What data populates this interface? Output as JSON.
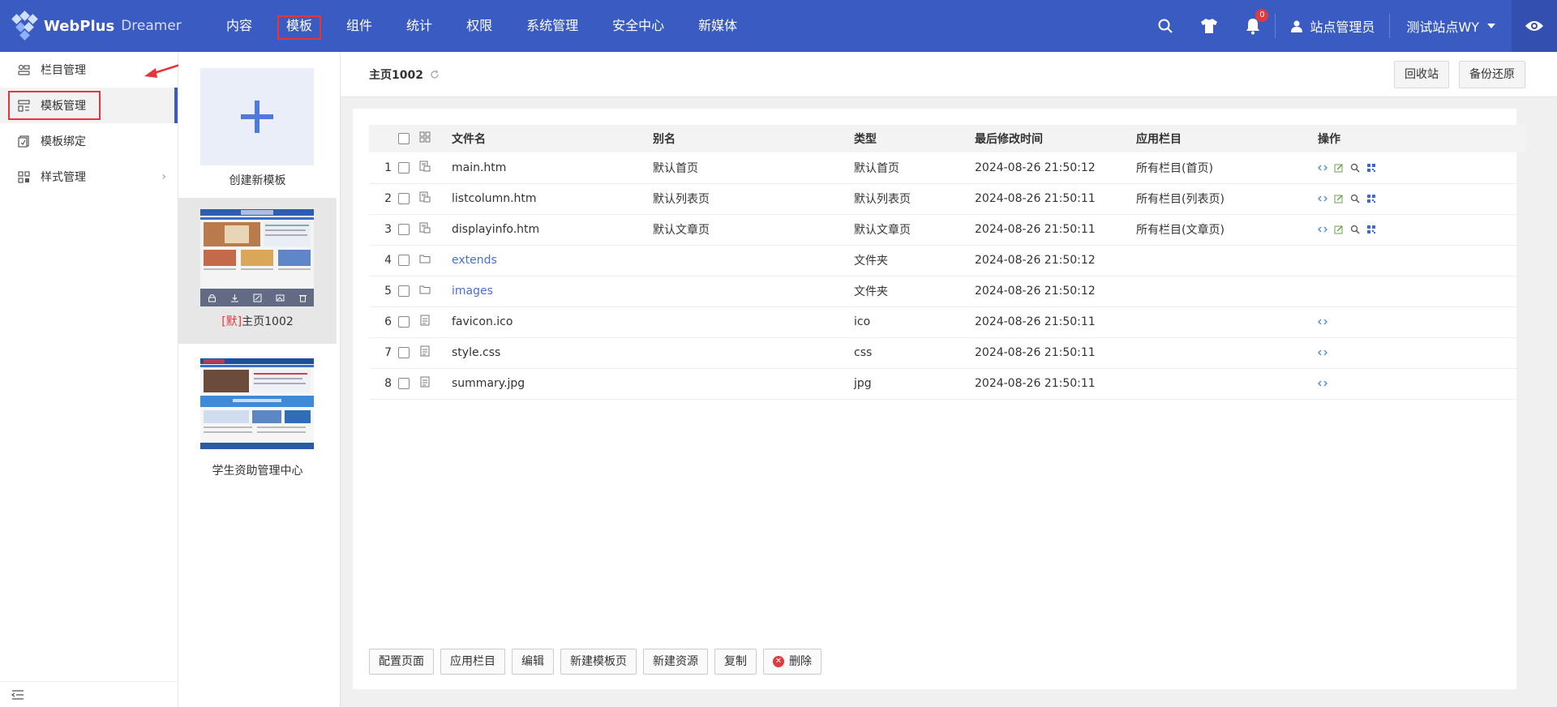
{
  "app": {
    "logo_text": "WebPlus",
    "logo_sub": "Dreamer"
  },
  "nav": {
    "items": [
      "内容",
      "模板",
      "组件",
      "统计",
      "权限",
      "系统管理",
      "安全中心",
      "新媒体"
    ],
    "active_index": 1
  },
  "topbar": {
    "notification_count": "0",
    "user_label": "站点管理员",
    "site_label": "测试站点WY"
  },
  "sidebar": {
    "items": [
      {
        "label": "栏目管理"
      },
      {
        "label": "模板管理"
      },
      {
        "label": "模板绑定"
      },
      {
        "label": "样式管理"
      }
    ],
    "active_index": 1
  },
  "templates": {
    "create_label": "创建新模板",
    "list": [
      {
        "prefix": "[默]",
        "name": "主页1002",
        "selected": true
      },
      {
        "prefix": "",
        "name": "学生资助管理中心",
        "selected": false
      }
    ]
  },
  "main": {
    "title": "主页1002",
    "recycle_label": "回收站",
    "backup_label": "备份还原",
    "columns": [
      "文件名",
      "别名",
      "类型",
      "最后修改时间",
      "应用栏目",
      "操作"
    ],
    "rows": [
      {
        "n": "1",
        "file": "main.htm",
        "alias": "默认首页",
        "type": "默认首页",
        "time": "2024-08-26 21:50:12",
        "column": "所有栏目(首页)",
        "kind": "template"
      },
      {
        "n": "2",
        "file": "listcolumn.htm",
        "alias": "默认列表页",
        "type": "默认列表页",
        "time": "2024-08-26 21:50:11",
        "column": "所有栏目(列表页)",
        "kind": "template"
      },
      {
        "n": "3",
        "file": "displayinfo.htm",
        "alias": "默认文章页",
        "type": "默认文章页",
        "time": "2024-08-26 21:50:11",
        "column": "所有栏目(文章页)",
        "kind": "template"
      },
      {
        "n": "4",
        "file": "extends",
        "alias": "",
        "type": "文件夹",
        "time": "2024-08-26 21:50:12",
        "column": "",
        "kind": "folder"
      },
      {
        "n": "5",
        "file": "images",
        "alias": "",
        "type": "文件夹",
        "time": "2024-08-26 21:50:12",
        "column": "",
        "kind": "folder"
      },
      {
        "n": "6",
        "file": "favicon.ico",
        "alias": "",
        "type": "ico",
        "time": "2024-08-26 21:50:11",
        "column": "",
        "kind": "file"
      },
      {
        "n": "7",
        "file": "style.css",
        "alias": "",
        "type": "css",
        "time": "2024-08-26 21:50:11",
        "column": "",
        "kind": "file"
      },
      {
        "n": "8",
        "file": "summary.jpg",
        "alias": "",
        "type": "jpg",
        "time": "2024-08-26 21:50:11",
        "column": "",
        "kind": "file"
      }
    ],
    "actions": [
      "配置页面",
      "应用栏目",
      "编辑",
      "新建模板页",
      "新建资源",
      "复制",
      "删除"
    ]
  },
  "colors": {
    "primary": "#3a5bc1",
    "highlight": "#e6343b",
    "link": "#4a6fcf"
  }
}
